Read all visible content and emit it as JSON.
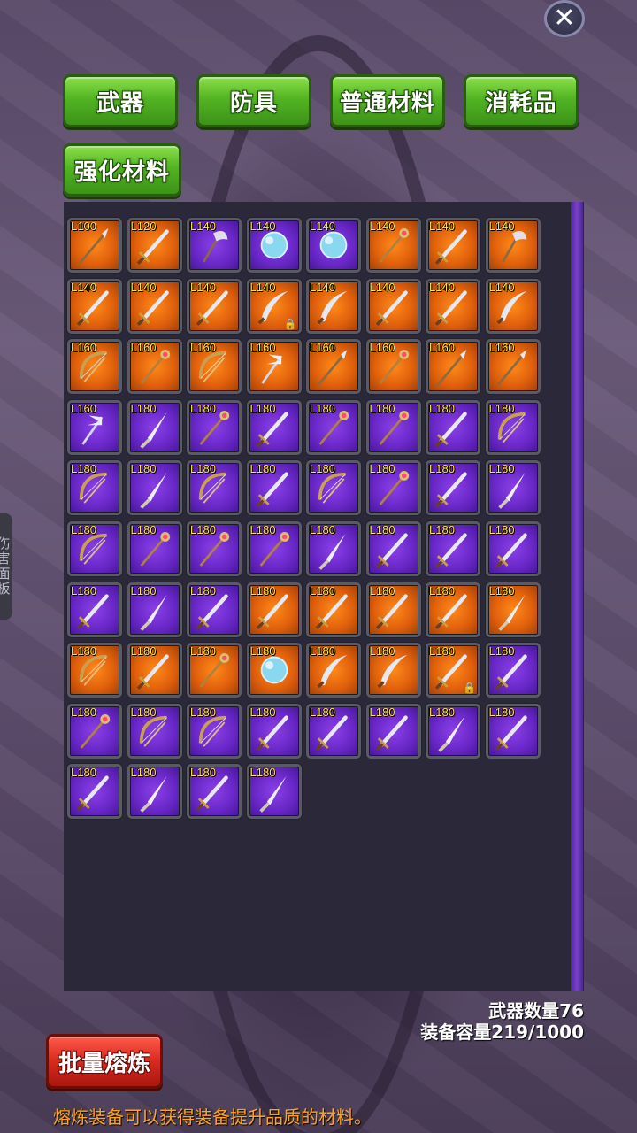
{
  "close_label": "✕",
  "tabs": [
    "武器",
    "防具",
    "普通材料",
    "消耗品",
    "强化材料"
  ],
  "side_tab_label": "伤害面板",
  "colors": {
    "tab_green": "#52b423",
    "slot_orange": "#e0600c",
    "slot_purple": "#6a28c8",
    "level_yellow": "#ffe92a",
    "hint_orange": "#ffa41a",
    "smelt_red": "#d82a1e"
  },
  "inventory": [
    {
      "level": "L100",
      "rarity": "orange",
      "icon": "spear-icon"
    },
    {
      "level": "L120",
      "rarity": "orange",
      "icon": "sword-icon"
    },
    {
      "level": "L140",
      "rarity": "purple",
      "icon": "axe-icon"
    },
    {
      "level": "L140",
      "rarity": "purple",
      "icon": "orb-icon"
    },
    {
      "level": "L140",
      "rarity": "purple",
      "icon": "orb-icon"
    },
    {
      "level": "L140",
      "rarity": "orange",
      "icon": "staff-icon"
    },
    {
      "level": "L140",
      "rarity": "orange",
      "icon": "scythe-icon"
    },
    {
      "level": "L140",
      "rarity": "orange",
      "icon": "axe-icon"
    },
    {
      "level": "L140",
      "rarity": "orange",
      "icon": "sword-icon"
    },
    {
      "level": "L140",
      "rarity": "orange",
      "icon": "sword-icon"
    },
    {
      "level": "L140",
      "rarity": "orange",
      "icon": "sword-icon"
    },
    {
      "level": "L140",
      "rarity": "orange",
      "icon": "scimitar-icon",
      "locked": true
    },
    {
      "level": "L140",
      "rarity": "orange",
      "icon": "scimitar-icon"
    },
    {
      "level": "L140",
      "rarity": "orange",
      "icon": "sword-icon"
    },
    {
      "level": "L140",
      "rarity": "orange",
      "icon": "sword-icon"
    },
    {
      "level": "L140",
      "rarity": "orange",
      "icon": "scimitar-icon"
    },
    {
      "level": "L160",
      "rarity": "orange",
      "icon": "bow-icon"
    },
    {
      "level": "L160",
      "rarity": "orange",
      "icon": "staff-icon"
    },
    {
      "level": "L160",
      "rarity": "orange",
      "icon": "bow-icon"
    },
    {
      "level": "L160",
      "rarity": "orange",
      "icon": "winged-staff-icon"
    },
    {
      "level": "L160",
      "rarity": "orange",
      "icon": "spear-icon"
    },
    {
      "level": "L160",
      "rarity": "orange",
      "icon": "staff-icon"
    },
    {
      "level": "L160",
      "rarity": "orange",
      "icon": "spear-icon"
    },
    {
      "level": "L160",
      "rarity": "orange",
      "icon": "spear-icon"
    },
    {
      "level": "L160",
      "rarity": "purple",
      "icon": "winged-staff-icon"
    },
    {
      "level": "L180",
      "rarity": "purple",
      "icon": "lance-icon"
    },
    {
      "level": "L180",
      "rarity": "purple",
      "icon": "staff-icon"
    },
    {
      "level": "L180",
      "rarity": "purple",
      "icon": "sword-icon"
    },
    {
      "level": "L180",
      "rarity": "purple",
      "icon": "staff-icon"
    },
    {
      "level": "L180",
      "rarity": "purple",
      "icon": "staff-icon"
    },
    {
      "level": "L180",
      "rarity": "purple",
      "icon": "sword-icon"
    },
    {
      "level": "L180",
      "rarity": "purple",
      "icon": "bow-icon"
    },
    {
      "level": "L180",
      "rarity": "purple",
      "icon": "bow-icon"
    },
    {
      "level": "L180",
      "rarity": "purple",
      "icon": "lance-icon"
    },
    {
      "level": "L180",
      "rarity": "purple",
      "icon": "bow-icon"
    },
    {
      "level": "L180",
      "rarity": "purple",
      "icon": "sword-icon"
    },
    {
      "level": "L180",
      "rarity": "purple",
      "icon": "bow-icon"
    },
    {
      "level": "L180",
      "rarity": "purple",
      "icon": "staff-icon"
    },
    {
      "level": "L180",
      "rarity": "purple",
      "icon": "sword-icon"
    },
    {
      "level": "L180",
      "rarity": "purple",
      "icon": "lance-icon"
    },
    {
      "level": "L180",
      "rarity": "purple",
      "icon": "bow-icon"
    },
    {
      "level": "L180",
      "rarity": "purple",
      "icon": "staff-icon"
    },
    {
      "level": "L180",
      "rarity": "purple",
      "icon": "staff-icon"
    },
    {
      "level": "L180",
      "rarity": "purple",
      "icon": "staff-icon"
    },
    {
      "level": "L180",
      "rarity": "purple",
      "icon": "lance-icon"
    },
    {
      "level": "L180",
      "rarity": "purple",
      "icon": "sword-icon"
    },
    {
      "level": "L180",
      "rarity": "purple",
      "icon": "sword-icon"
    },
    {
      "level": "L180",
      "rarity": "purple",
      "icon": "sword-icon"
    },
    {
      "level": "L180",
      "rarity": "purple",
      "icon": "sword-icon"
    },
    {
      "level": "L180",
      "rarity": "purple",
      "icon": "lance-icon"
    },
    {
      "level": "L180",
      "rarity": "purple",
      "icon": "sword-icon"
    },
    {
      "level": "L180",
      "rarity": "orange",
      "icon": "sword-icon"
    },
    {
      "level": "L180",
      "rarity": "orange",
      "icon": "sword-icon"
    },
    {
      "level": "L180",
      "rarity": "orange",
      "icon": "sword-icon"
    },
    {
      "level": "L180",
      "rarity": "orange",
      "icon": "sword-icon"
    },
    {
      "level": "L180",
      "rarity": "orange",
      "icon": "lance-icon"
    },
    {
      "level": "L180",
      "rarity": "orange",
      "icon": "bow-icon"
    },
    {
      "level": "L180",
      "rarity": "orange",
      "icon": "sword-icon"
    },
    {
      "level": "L180",
      "rarity": "orange",
      "icon": "staff-icon"
    },
    {
      "level": "L180",
      "rarity": "orange",
      "icon": "orb-icon"
    },
    {
      "level": "L180",
      "rarity": "orange",
      "icon": "scimitar-icon"
    },
    {
      "level": "L180",
      "rarity": "orange",
      "icon": "scimitar-icon"
    },
    {
      "level": "L180",
      "rarity": "orange",
      "icon": "sword-icon",
      "locked": true
    },
    {
      "level": "L180",
      "rarity": "purple",
      "icon": "sword-icon"
    },
    {
      "level": "L180",
      "rarity": "purple",
      "icon": "staff-icon"
    },
    {
      "level": "L180",
      "rarity": "purple",
      "icon": "bow-icon"
    },
    {
      "level": "L180",
      "rarity": "purple",
      "icon": "bow-icon"
    },
    {
      "level": "L180",
      "rarity": "purple",
      "icon": "sword-icon"
    },
    {
      "level": "L180",
      "rarity": "purple",
      "icon": "sword-icon"
    },
    {
      "level": "L180",
      "rarity": "purple",
      "icon": "sword-icon"
    },
    {
      "level": "L180",
      "rarity": "purple",
      "icon": "lance-icon"
    },
    {
      "level": "L180",
      "rarity": "purple",
      "icon": "sword-icon"
    },
    {
      "level": "L180",
      "rarity": "purple",
      "icon": "sword-icon"
    },
    {
      "level": "L180",
      "rarity": "purple",
      "icon": "lance-icon"
    },
    {
      "level": "L180",
      "rarity": "purple",
      "icon": "sword-icon"
    },
    {
      "level": "L180",
      "rarity": "purple",
      "icon": "lance-icon"
    }
  ],
  "weapon_count": "武器数量76",
  "capacity": "装备容量219/1000",
  "smelt_label": "批量熔炼",
  "hint": "熔炼装备可以获得装备提升品质的材料。"
}
